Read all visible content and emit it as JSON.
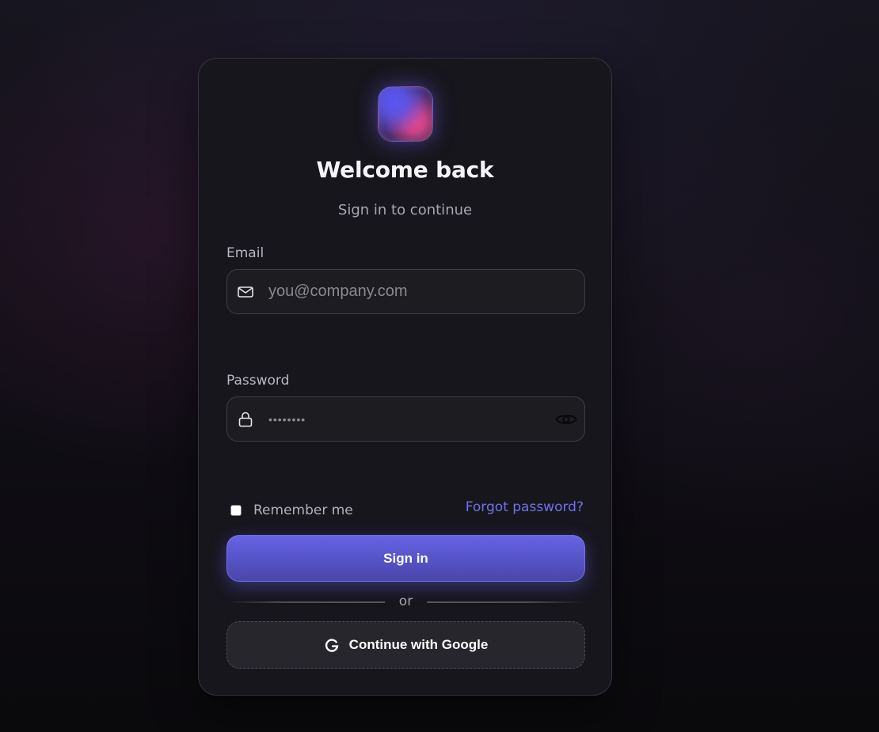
{
  "header": {
    "title": "Welcome back",
    "subtitle": "Sign in to continue",
    "logo_icon": "brand-logo-gradient-square"
  },
  "form": {
    "email": {
      "label": "Email",
      "value": "",
      "placeholder": "you@company.com",
      "icon": "mail-icon"
    },
    "password": {
      "label": "Password",
      "value": "••••••••",
      "icon": "lock-icon",
      "toggle_icon": "eye-icon"
    },
    "remember": {
      "label": "Remember me",
      "checked": false
    },
    "forgot_label": "Forgot password?",
    "submit_label": "Sign in",
    "divider_label": "or",
    "google_label": "Continue with Google",
    "google_icon": "google-g-icon"
  },
  "colors": {
    "accent": "#6562e3",
    "link": "#7170ee",
    "card_background": "#17161c",
    "logo_blue": "#5b57f0",
    "logo_pink": "#e2478f"
  }
}
